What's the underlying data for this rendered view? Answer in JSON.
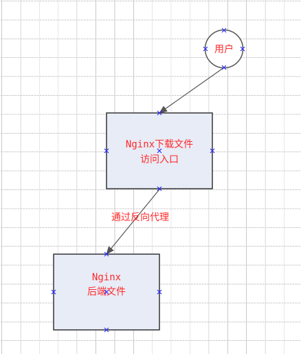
{
  "diagram": {
    "nodes": {
      "user": {
        "label": "用户"
      },
      "entry": {
        "label_line1": "Nginx下载文件",
        "label_line2": "访问入口"
      },
      "backend": {
        "label_line1": "Nginx",
        "label_line2": "后端文件"
      }
    },
    "edges": {
      "user_to_entry": {
        "label": ""
      },
      "entry_to_backend": {
        "label": "通过反向代理"
      }
    },
    "colors": {
      "box_fill": "#e8ecf6",
      "box_stroke": "#333333",
      "label_text": "#ff2a2a",
      "handle": "#2a2aff",
      "grid": "#c9c9c9",
      "arrow": "#555555"
    }
  }
}
